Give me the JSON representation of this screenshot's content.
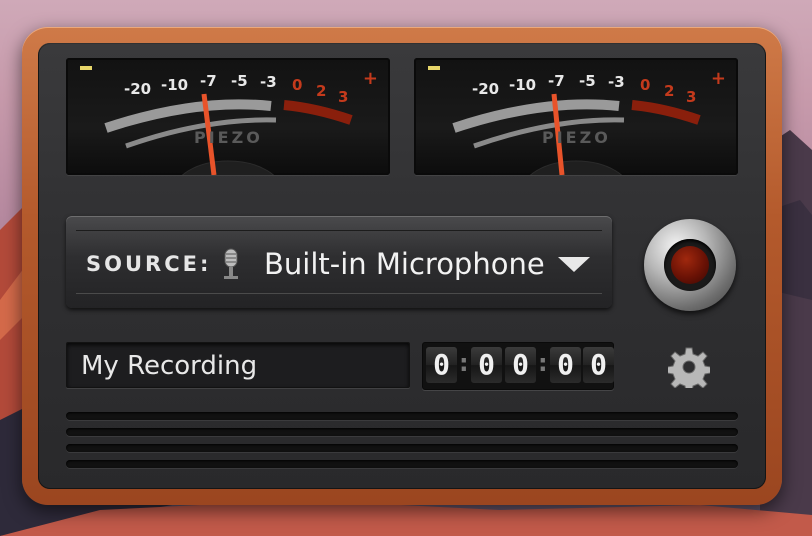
{
  "meters": [
    {
      "scale": {
        "m20": "-20",
        "m10": "-10",
        "m7": "-7",
        "m5": "-5",
        "m3": "-3",
        "p0": "0",
        "p2": "2",
        "p3": "3"
      },
      "minus": "–",
      "plus": "+",
      "brand": "PIEZO"
    },
    {
      "scale": {
        "m20": "-20",
        "m10": "-10",
        "m7": "-7",
        "m5": "-5",
        "m3": "-3",
        "p0": "0",
        "p2": "2",
        "p3": "3"
      },
      "minus": "–",
      "plus": "+",
      "brand": "PIEZO"
    }
  ],
  "source": {
    "label": "SOURCE:",
    "value": "Built-in Microphone",
    "icon": "microphone-icon",
    "dropdown_icon": "caret-down-icon"
  },
  "record_button": {
    "icon": "record-icon",
    "color": "#8a1a0a"
  },
  "recording_name": "My Recording",
  "timer": {
    "d1": "0",
    "d2": "0",
    "d3": "0",
    "d4": "0",
    "d5": "0",
    "sep": ":"
  },
  "settings": {
    "icon": "gear-icon"
  },
  "accent": {
    "wood": "#b45a2c",
    "needle": "#e8532a",
    "meter_red": "#c43a1c",
    "meter_yellow": "#e7d66a"
  }
}
